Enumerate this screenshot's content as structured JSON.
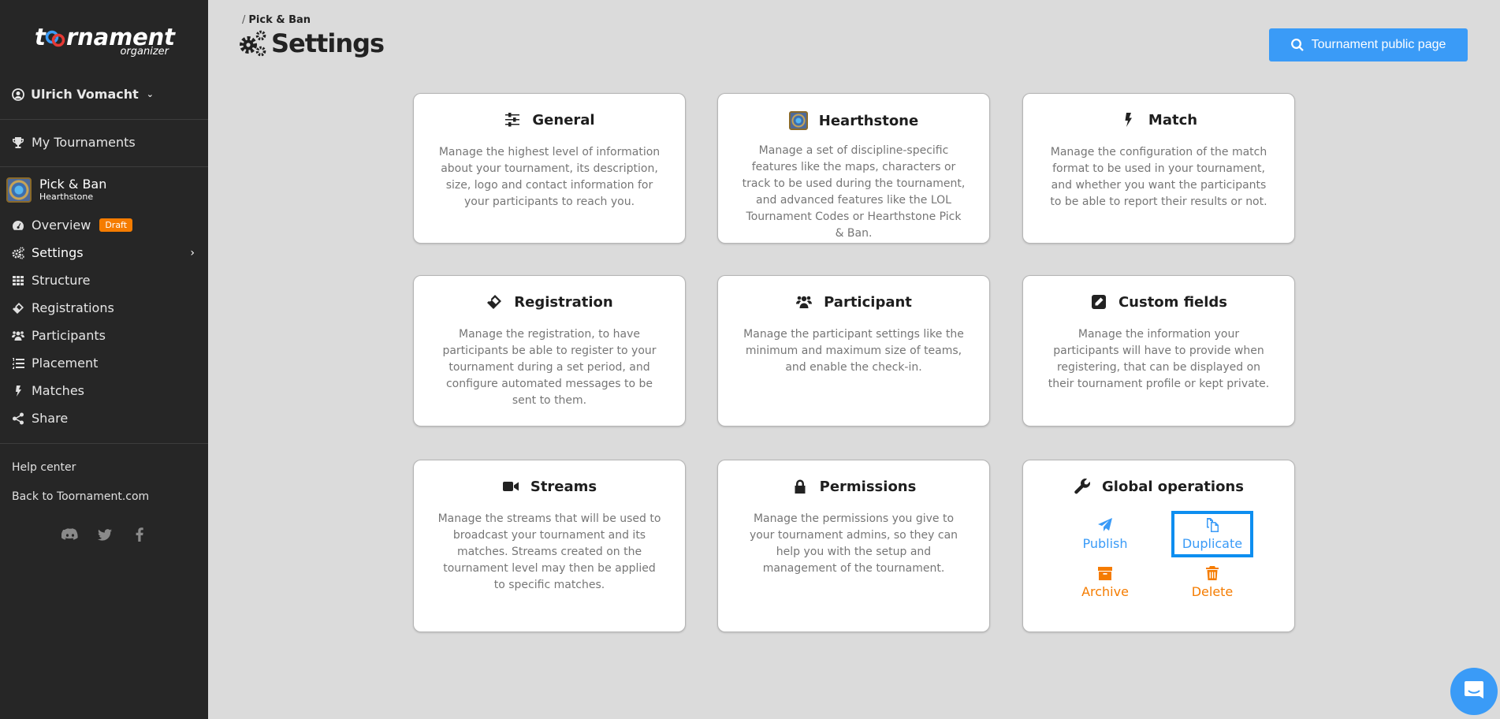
{
  "sidebar": {
    "logo": {
      "word": "toornament",
      "sub": "organizer"
    },
    "user": {
      "name": "Ulrich Vomacht",
      "icon": "user-circle-icon"
    },
    "my_tournaments": {
      "label": "My Tournaments",
      "icon": "trophy-icon"
    },
    "tournament": {
      "name": "Pick & Ban",
      "discipline": "Hearthstone"
    },
    "nav": [
      {
        "label": "Overview",
        "icon": "dashboard-icon",
        "badge": "Draft"
      },
      {
        "label": "Settings",
        "icon": "cogs-icon",
        "active": true
      },
      {
        "label": "Structure",
        "icon": "grid-icon"
      },
      {
        "label": "Registrations",
        "icon": "ticket-icon"
      },
      {
        "label": "Participants",
        "icon": "users-icon"
      },
      {
        "label": "Placement",
        "icon": "ordered-list-icon"
      },
      {
        "label": "Matches",
        "icon": "bolt-icon"
      },
      {
        "label": "Share",
        "icon": "share-icon"
      }
    ],
    "footer": {
      "help": "Help center",
      "back": "Back to Toornament.com",
      "socials": [
        "discord-icon",
        "twitter-icon",
        "facebook-icon"
      ]
    }
  },
  "header": {
    "breadcrumb_sep": "/",
    "breadcrumb": "Pick & Ban",
    "title": "Settings",
    "public_button": "Tournament public page"
  },
  "cards": [
    {
      "title": "General",
      "icon": "sliders-icon",
      "desc": "Manage the highest level of information about your tournament, its description, size, logo and contact information for your participants to reach you."
    },
    {
      "title": "Hearthstone",
      "icon": "hearthstone-logo-icon",
      "desc": "Manage a set of discipline-specific features like the maps, characters or track to be used during the tournament, and advanced features like the LOL Tournament Codes or Hearthstone Pick & Ban."
    },
    {
      "title": "Match",
      "icon": "bolt-icon",
      "desc": "Manage the configuration of the match format to be used in your tournament, and whether you want the participants to be able to report their results or not."
    },
    {
      "title": "Registration",
      "icon": "ticket-icon",
      "desc": "Manage the registration, to have participants be able to register to your tournament during a set period, and configure automated messages to be sent to them."
    },
    {
      "title": "Participant",
      "icon": "users-icon",
      "desc": "Manage the participant settings like the minimum and maximum size of teams, and enable the check-in."
    },
    {
      "title": "Custom fields",
      "icon": "edit-icon",
      "desc": "Manage the information your participants will have to provide when registering, that can be displayed on their tournament profile or kept private."
    },
    {
      "title": "Streams",
      "icon": "video-camera-icon",
      "desc": "Manage the streams that will be used to broadcast your tournament and its matches. Streams created on the tournament level may then be applied to specific matches."
    },
    {
      "title": "Permissions",
      "icon": "lock-icon",
      "desc": "Manage the permissions you give to your tournament admins, so they can help you with the setup and management of the tournament."
    }
  ],
  "global_ops": {
    "title": "Global operations",
    "icon": "wrench-icon",
    "actions": [
      {
        "label": "Publish",
        "icon": "paper-plane-icon",
        "color": "#3a9bf7"
      },
      {
        "label": "Duplicate",
        "icon": "copy-icon",
        "color": "#3a9bf7",
        "focused": true
      },
      {
        "label": "Archive",
        "icon": "archive-box-icon",
        "color": "#f57c00"
      },
      {
        "label": "Delete",
        "icon": "trash-icon",
        "color": "#f57c00"
      }
    ]
  },
  "colors": {
    "sidebar_bg": "#262626",
    "page_bg": "#dbdbdb",
    "accent": "#3a9bf7",
    "warning": "#f57c00"
  },
  "chat_widget": {
    "icon": "chat-bubble-icon"
  }
}
